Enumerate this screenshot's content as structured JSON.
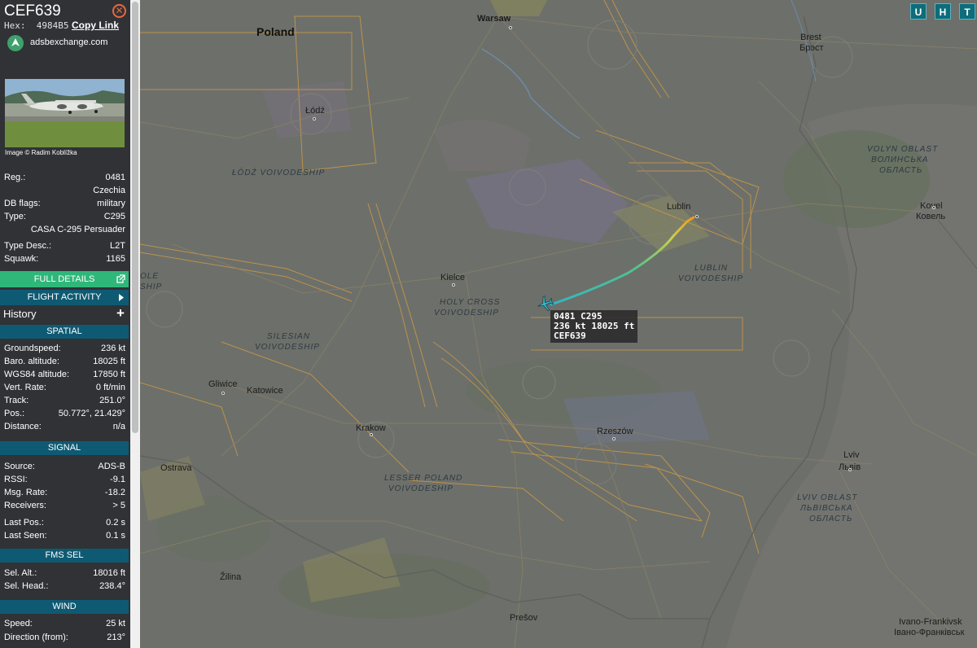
{
  "aircraft": {
    "callsign": "CEF639",
    "hex_label": "Hex:",
    "hex": "4984B5",
    "copy_link": "Copy Link",
    "brand": "adsbexchange.com",
    "photo_credit": "Image © Radim Koblížka"
  },
  "details": {
    "reg_label": "Reg.:",
    "reg": "0481",
    "country": "Czechia",
    "dbflags_label": "DB flags:",
    "dbflags": "military",
    "type_label": "Type:",
    "type": "C295",
    "type_full": "CASA C-295 Persuader",
    "typedesc_label": "Type Desc.:",
    "typedesc": "L2T",
    "squawk_label": "Squawk:",
    "squawk": "1165"
  },
  "buttons": {
    "full_details": "FULL DETAILS",
    "flight_activity": "FLIGHT ACTIVITY",
    "history": "History"
  },
  "spatial": {
    "title": "SPATIAL",
    "rows": [
      {
        "label": "Groundspeed:",
        "value": "236 kt"
      },
      {
        "label": "Baro. altitude:",
        "value": "18025 ft"
      },
      {
        "label": "WGS84 altitude:",
        "value": "17850 ft"
      },
      {
        "label": "Vert. Rate:",
        "value": "0 ft/min"
      },
      {
        "label": "Track:",
        "value": "251.0°"
      },
      {
        "label": "Pos.:",
        "value": "50.772°, 21.429°"
      },
      {
        "label": "Distance:",
        "value": "n/a"
      }
    ]
  },
  "signal": {
    "title": "SIGNAL",
    "rows": [
      {
        "label": "Source:",
        "value": "ADS-B"
      },
      {
        "label": "RSSI:",
        "value": "-9.1"
      },
      {
        "label": "Msg. Rate:",
        "value": "-18.2"
      },
      {
        "label": "Receivers:",
        "value": "> 5"
      },
      {
        "label": "Last Pos.:",
        "value": "0.2 s"
      },
      {
        "label": "Last Seen:",
        "value": "0.1 s"
      }
    ]
  },
  "fms": {
    "title": "FMS SEL",
    "rows": [
      {
        "label": "Sel. Alt.:",
        "value": "18016 ft"
      },
      {
        "label": "Sel. Head.:",
        "value": "238.4°"
      }
    ]
  },
  "wind": {
    "title": "WIND",
    "rows": [
      {
        "label": "Speed:",
        "value": "25 kt"
      },
      {
        "label": "Direction (from):",
        "value": "213°"
      }
    ]
  },
  "map_buttons": [
    "U",
    "H",
    "T"
  ],
  "map_labels": {
    "warsaw": "Warsaw",
    "poland": "Poland",
    "lodz": "Łódź",
    "brest": "Brest",
    "brest_cyr": "Брэст",
    "lodz_voiv": "ŁÓDŹ VOIVODESHIP",
    "volyn": "VOLYN OBLAST",
    "volyn_cyr": "ВОЛИНСЬКА",
    "volyn_cyr2": "ОБЛАСТЬ",
    "lublin": "Lublin",
    "kovel": "Kovel",
    "kovel_cyr": "Ковель",
    "kielce": "Kielce",
    "holy_cross": "HOLY CROSS",
    "holy_cross2": "VOIVODESHIP",
    "lublin_voiv": "LUBLIN",
    "lublin_voiv2": "VOIVODESHIP",
    "ole": "OLE",
    "ship": "SHIP",
    "silesian": "SILESIAN",
    "silesian2": "VOIVODESHIP",
    "gliwice": "Gliwice",
    "katowice": "Katowice",
    "krakow": "Krakow",
    "rzeszow": "Rzeszów",
    "ostrava": "Ostrava",
    "lesser": "LESSER POLAND",
    "lesser2": "VOIVODESHIP",
    "lviv": "Lviv",
    "lviv_cyr": "Львів",
    "lviv_obl": "LVIV OBLAST",
    "lviv_obl_cyr": "ЛЬВІВСЬКА",
    "lviv_obl_cyr2": "ОБЛАСТЬ",
    "zilina": "Žilina",
    "presov": "Prešov",
    "ivano": "Ivano-Frankivsk",
    "ivano_cyr": "Івано-Франківськ"
  },
  "aircraft_label": {
    "line1": "0481 C295",
    "line2": "236 kt  18025 ft",
    "line3": "CEF639"
  },
  "colors": {
    "panel_bg": "#303236",
    "section_header": "#0f5a73",
    "full_details": "#2fb77a",
    "close": "#e8693c",
    "track_start": "#2fb8c4",
    "track_end": "#f29a1e"
  }
}
